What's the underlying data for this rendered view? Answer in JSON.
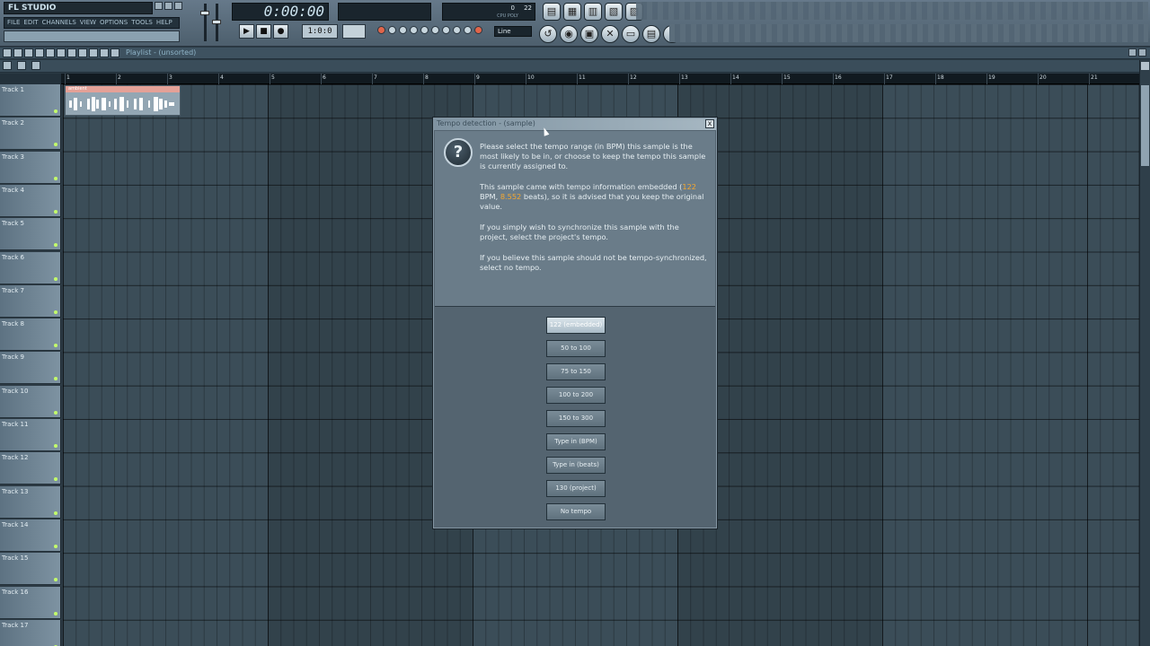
{
  "app": {
    "title": "FL STUDIO",
    "menu": [
      "FILE",
      "EDIT",
      "CHANNELS",
      "VIEW",
      "OPTIONS",
      "TOOLS",
      "HELP"
    ]
  },
  "transport": {
    "time": "0:00:00",
    "play_icon": "play-icon",
    "stop_icon": "stop-icon",
    "record_icon": "record-icon",
    "pattern": "1:0:0",
    "snap": "Line"
  },
  "cpu": {
    "value1": "0",
    "value2": "22",
    "labels": "CPU  POLY"
  },
  "playlist": {
    "title": "Playlist - (unsorted)"
  },
  "ruler": {
    "bars": [
      "1",
      "2",
      "3",
      "4",
      "5",
      "6",
      "7",
      "8",
      "9",
      "10",
      "11",
      "12",
      "13",
      "14",
      "15",
      "16",
      "17",
      "18",
      "19",
      "20",
      "21"
    ]
  },
  "tracks": [
    "Track 1",
    "Track 2",
    "Track 3",
    "Track 4",
    "Track 5",
    "Track 6",
    "Track 7",
    "Track 8",
    "Track 9",
    "Track 10",
    "Track 11",
    "Track 12",
    "Track 13",
    "Track 14",
    "Track 15",
    "Track 16",
    "Track 17"
  ],
  "clip": {
    "title": "ambient"
  },
  "dialog": {
    "title": "Tempo detection - (sample)",
    "icon": "question-icon",
    "close": "x",
    "para1": "Please select the tempo range (in BPM) this sample is the most likely to be in, or choose to keep the tempo this sample is currently assigned to.",
    "para2_a": "This sample came with tempo information embedded (",
    "para2_bpm": "122",
    "para2_b": " BPM, ",
    "para2_beats": "8.552",
    "para2_c": " beats), so it is advised that you keep the original value.",
    "para3": "If you simply wish to synchronize this sample with the project, select the project's tempo.",
    "para4": "If you believe this sample should not be tempo-synchronized, select no tempo.",
    "options": [
      "122 (embedded)",
      "50 to 100",
      "75 to 150",
      "100 to 200",
      "150 to 300",
      "Type in (BPM)",
      "Type in (beats)",
      "130 (project)",
      "No tempo"
    ]
  },
  "colors": {
    "accent_highlight": "#f5a830",
    "clip_header": "#e4a197",
    "track_led": "#c3ff6a"
  }
}
